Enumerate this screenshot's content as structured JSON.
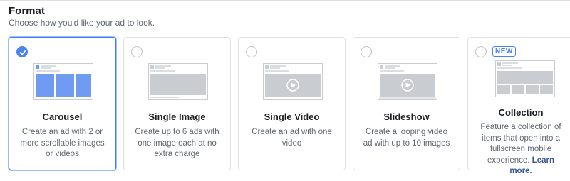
{
  "format": {
    "title": "Format",
    "subtitle": "Choose how you'd like your ad to look."
  },
  "cards": [
    {
      "id": "carousel",
      "title": "Carousel",
      "description": "Create an ad with 2 or more scrollable images or videos",
      "selected": true
    },
    {
      "id": "single-image",
      "title": "Single Image",
      "description": "Create up to 6 ads with one image each at no extra charge",
      "selected": false
    },
    {
      "id": "single-video",
      "title": "Single Video",
      "description": "Create an ad with one video",
      "selected": false
    },
    {
      "id": "slideshow",
      "title": "Slideshow",
      "description": "Create a looping video ad with up to 10 images",
      "selected": false
    },
    {
      "id": "collection",
      "title": "Collection",
      "description": "Feature a collection of items that open into a fullscreen mobile experience.",
      "link": "Learn more.",
      "badge": "NEW",
      "selected": false
    }
  ],
  "colors": {
    "accent": "#4a84f0",
    "selected_border": "#4080ff",
    "preview_fill": "#c9ccd1",
    "selected_preview_fill": "#6f9cf2",
    "link": "#385898"
  },
  "icons": {
    "selected_check": "checkmark-icon",
    "video_play": "play-icon"
  }
}
